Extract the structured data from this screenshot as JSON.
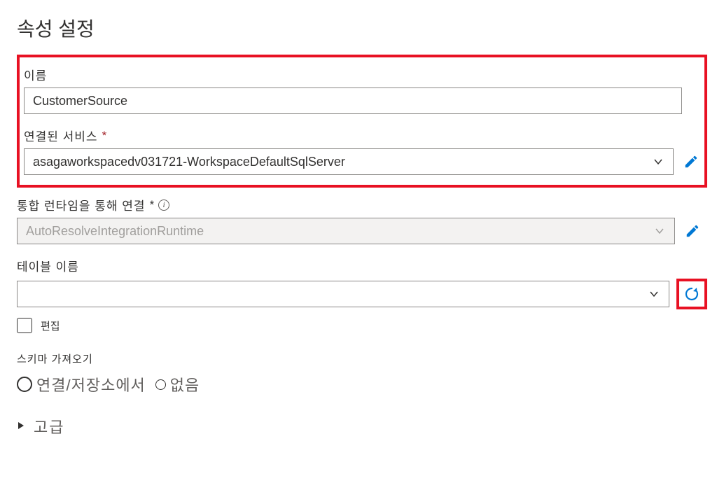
{
  "title": "속성 설정",
  "nameField": {
    "label": "이름",
    "value": "CustomerSource"
  },
  "linkedService": {
    "label": "연결된 서비스",
    "value": "asagaworkspacedv031721-WorkspaceDefaultSqlServer"
  },
  "integrationRuntime": {
    "label": "통합 런타임을 통해 연결",
    "value": "AutoResolveIntegrationRuntime"
  },
  "tableName": {
    "label": "테이블 이름",
    "value": ""
  },
  "editCheckbox": {
    "label": "편집"
  },
  "schemaImport": {
    "label": "스키마 가져오기",
    "option1": "연결/저장소에서",
    "option2": "없음"
  },
  "advanced": {
    "label": "고급"
  }
}
